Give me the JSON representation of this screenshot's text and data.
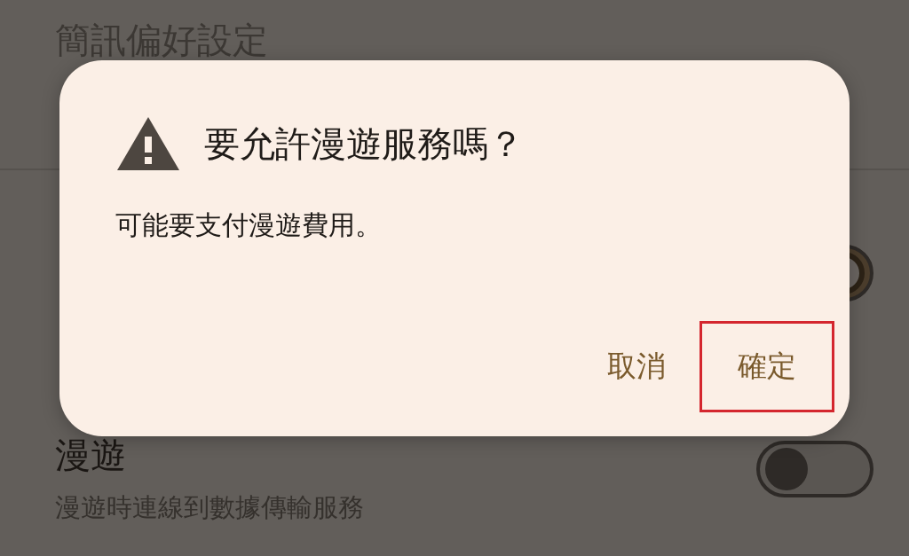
{
  "settings": {
    "heading": "簡訊偏好設定",
    "rows": [
      {
        "on": true
      },
      {
        "title": "漫遊",
        "subtitle": "漫遊時連線到數據傳輸服務",
        "on": false
      }
    ]
  },
  "dialog": {
    "title": "要允許漫遊服務嗎？",
    "message": "可能要支付漫遊費用。",
    "buttons": [
      {
        "label": "取消",
        "highlighted": false
      },
      {
        "label": "確定",
        "highlighted": true
      }
    ]
  }
}
